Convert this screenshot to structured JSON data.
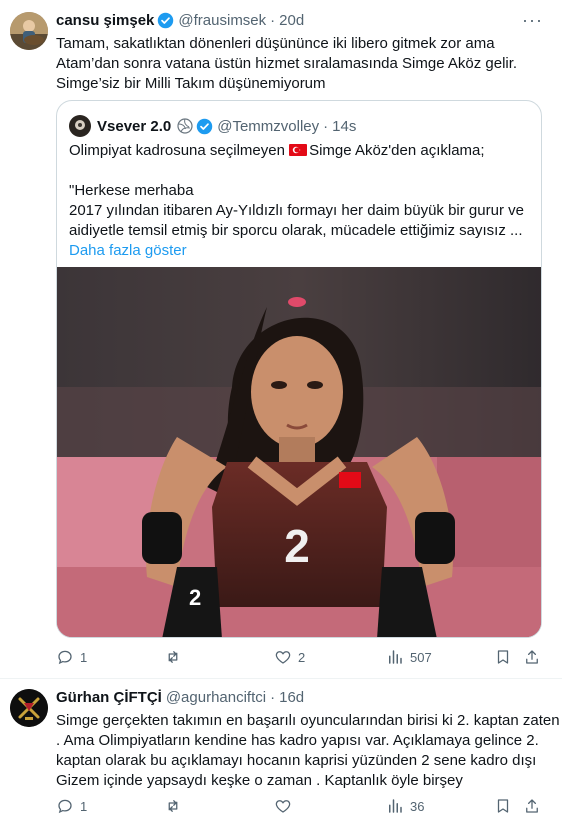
{
  "tweet1": {
    "name": "cansu şimşek",
    "handle": "@frausimsek",
    "time": "20d",
    "lines": [
      "Tamam, sakatlıktan dönenleri düşününce iki libero gitmek zor ama",
      "Atam’dan sonra vatana üstün hizmet sıralamasında Simge Aköz gelir.",
      "Simge’siz bir Milli Takım düşünemiyorum"
    ],
    "quote": {
      "name": "Vsever 2.0",
      "handle": "@Temmzvolley",
      "time": "14s",
      "line1_pre": "Olimpiyat kadrosuna seçilmeyen ",
      "line1_post": "Simge Aköz'den açıklama;",
      "lines": [
        "\"Herkese merhaba",
        "2017 yılından itibaren Ay-Yıldızlı formayı her daim büyük bir gurur ve",
        "aidiyetle temsil etmiş bir sporcu olarak, mücadele ettiğimiz sayısız ..."
      ],
      "show_more": "Daha fazla göster",
      "jersey_number": "2"
    },
    "actions": {
      "replies": "1",
      "likes": "2",
      "views": "507"
    }
  },
  "tweet2": {
    "name": "Gürhan ÇİFTÇİ",
    "handle": "@agurhanciftci",
    "time": "16d",
    "lines": [
      "Simge gerçekten takımın en başarılı oyuncularından birisi ki 2. kaptan zaten",
      ". Ama Olimpiyatların kendine has kadro yapısı var. Açıklamaya gelince 2.",
      "kaptan olarak bu açıklamayı hocanın kaprisi yüzünden 2 sene kadro dışı",
      "Gizem içinde yapsaydı keşke o zaman . Kaptanlık öyle birşey"
    ],
    "actions": {
      "replies": "1",
      "views": "36"
    }
  },
  "colors": {
    "accent": "#1d9bf0",
    "muted": "#536471",
    "text": "#0f1419"
  }
}
